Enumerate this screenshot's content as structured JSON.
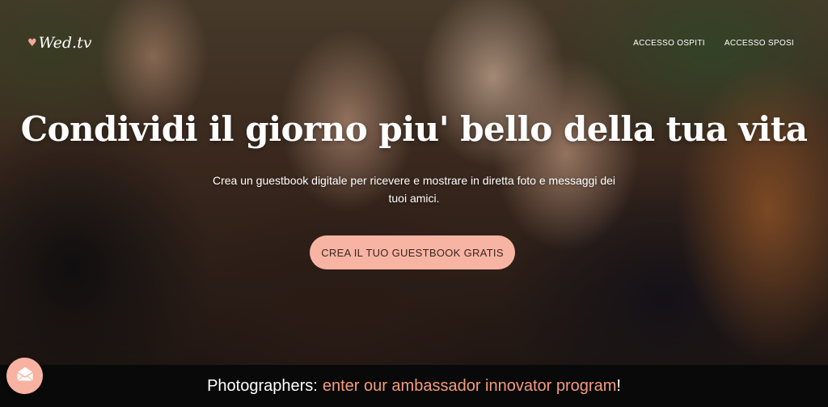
{
  "header": {
    "logo_text": "Wed.tv",
    "nav": [
      {
        "label": "ACCESSO OSPITI"
      },
      {
        "label": "ACCESSO SPOSI"
      }
    ]
  },
  "hero": {
    "title": "Condividi il giorno piu' bello della tua vita",
    "subtitle": "Crea un guestbook digitale per ricevere e mostrare in diretta foto e messaggi dei tuoi amici.",
    "cta_label": "CREA IL TUO GUESTBOOK GRATIS"
  },
  "promo": {
    "prefix": "Photographers:",
    "link_text": "enter our ambassador innovator program",
    "suffix": "!"
  },
  "fab": {
    "icon": "envelope-icon"
  },
  "colors": {
    "accent": "#f8b4a3",
    "promo_link": "#f59b7d",
    "promo_bg": "#0a0909"
  }
}
